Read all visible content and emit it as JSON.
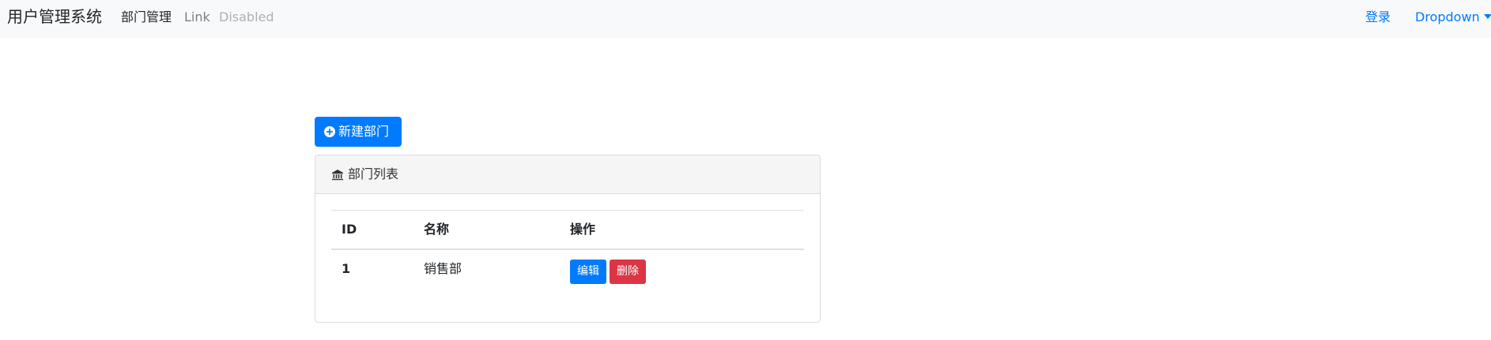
{
  "navbar": {
    "brand": "用户管理系统",
    "links": {
      "active": "部门管理",
      "link": "Link",
      "disabled": "Disabled"
    },
    "right": {
      "login": "登录",
      "dropdown": "Dropdown"
    }
  },
  "toolbar": {
    "new_button_label": "新建部门"
  },
  "panel": {
    "title": "部门列表",
    "table": {
      "headers": {
        "id": "ID",
        "name": "名称",
        "actions": "操作"
      },
      "rows": [
        {
          "id": "1",
          "name": "销售部",
          "edit_label": "编辑",
          "delete_label": "删除"
        }
      ]
    }
  },
  "colors": {
    "primary": "#007bff",
    "danger": "#dc3545",
    "navbar_bg": "#f8f9fa",
    "panel_header_bg": "#f5f5f5"
  },
  "icons": {
    "new_button": "plus-circle-icon",
    "panel_title": "bank-icon",
    "dropdown": "caret-down-icon"
  }
}
